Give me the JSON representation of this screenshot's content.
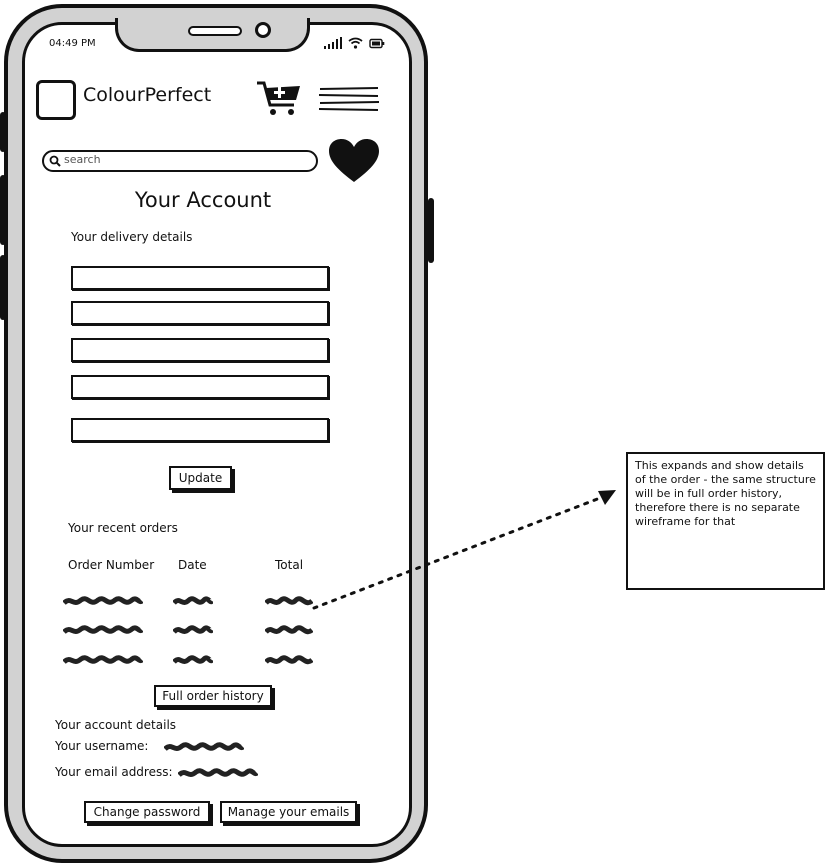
{
  "status": {
    "time": "04:49 PM"
  },
  "header": {
    "brand": "ColourPerfect"
  },
  "search": {
    "placeholder": "search"
  },
  "page": {
    "title": "Your Account"
  },
  "delivery": {
    "heading": "Your delivery details",
    "update_label": "Update"
  },
  "orders": {
    "heading": "Your recent orders",
    "columns": [
      "Order Number",
      "Date",
      "Total"
    ],
    "history_label": "Full order history"
  },
  "account": {
    "heading": "Your account details",
    "username_label": "Your username:",
    "email_label": "Your email address:",
    "change_password_label": "Change password",
    "manage_emails_label": "Manage your emails"
  },
  "annotation": {
    "text": "This expands and show details of the order - the same structure will be in full order history, therefore there is no separate wireframe for that"
  },
  "icons": {
    "logo": "logo-placeholder-icon",
    "cart": "add-to-cart-icon",
    "menu": "hamburger-menu-icon",
    "search": "search-icon",
    "favourites": "heart-icon"
  }
}
